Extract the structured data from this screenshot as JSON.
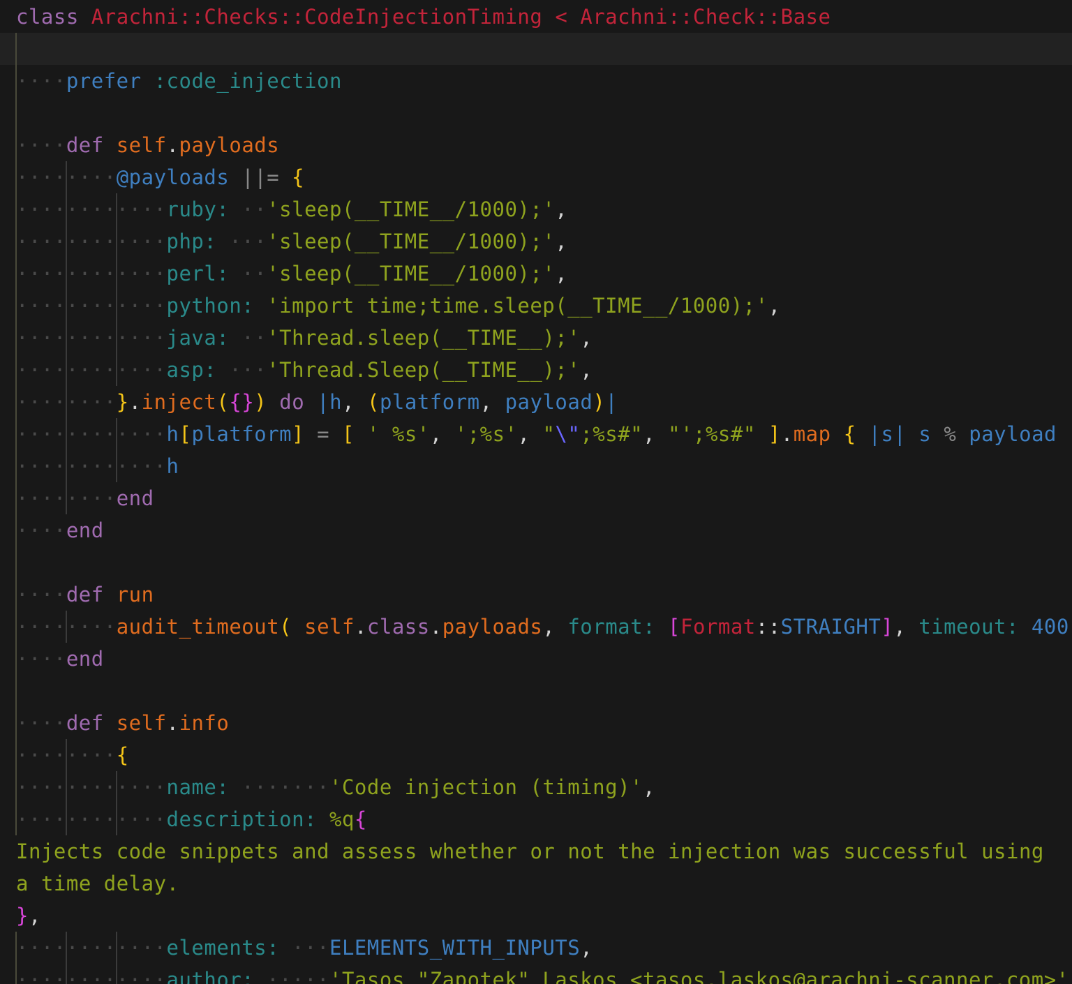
{
  "editor": {
    "language": "ruby",
    "current_line": 2,
    "lines": [
      "class Arachni::Checks::CodeInjectionTiming < Arachni::Check::Base",
      "",
      "    prefer :code_injection",
      "",
      "    def self.payloads",
      "        @payloads ||= {",
      "            ruby:   'sleep(__TIME__/1000);',",
      "            php:    'sleep(__TIME__/1000);',",
      "            perl:   'sleep(__TIME__/1000);',",
      "            python: 'import time;time.sleep(__TIME__/1000);',",
      "            java:   'Thread.sleep(__TIME__);',",
      "            asp:    'Thread.Sleep(__TIME__);',",
      "        }.inject({}) do |h, (platform, payload)|",
      "            h[platform] = [ ' %s', ';%s', \"\\\";%s#\", \"';%s#\" ].map { |s| s % payload",
      "            h",
      "        end",
      "    end",
      "",
      "    def run",
      "        audit_timeout( self.class.payloads, format: [Format::STRAIGHT], timeout: 400",
      "    end",
      "",
      "    def self.info",
      "        {",
      "            name:        'Code injection (timing)',",
      "            description: %q{",
      "Injects code snippets and assess whether or not the injection was successful using",
      "a time delay.",
      "},",
      "            elements:    ELEMENTS_WITH_INPUTS,",
      "            author:      'Tasos \"Zapotek\" Laskos <tasos.laskos@arachni-scanner.com>'"
    ]
  },
  "theme": {
    "background": "#181818",
    "current_line_background": "#222222",
    "keyword": "#a06bb0",
    "class_name": "#c3243a",
    "method": "#e06c1f",
    "variable": "#3f7fc0",
    "symbol": "#2a8a8a",
    "string": "#8fa31e",
    "brace_level1": "#f5c518",
    "brace_level2": "#d946d9"
  }
}
